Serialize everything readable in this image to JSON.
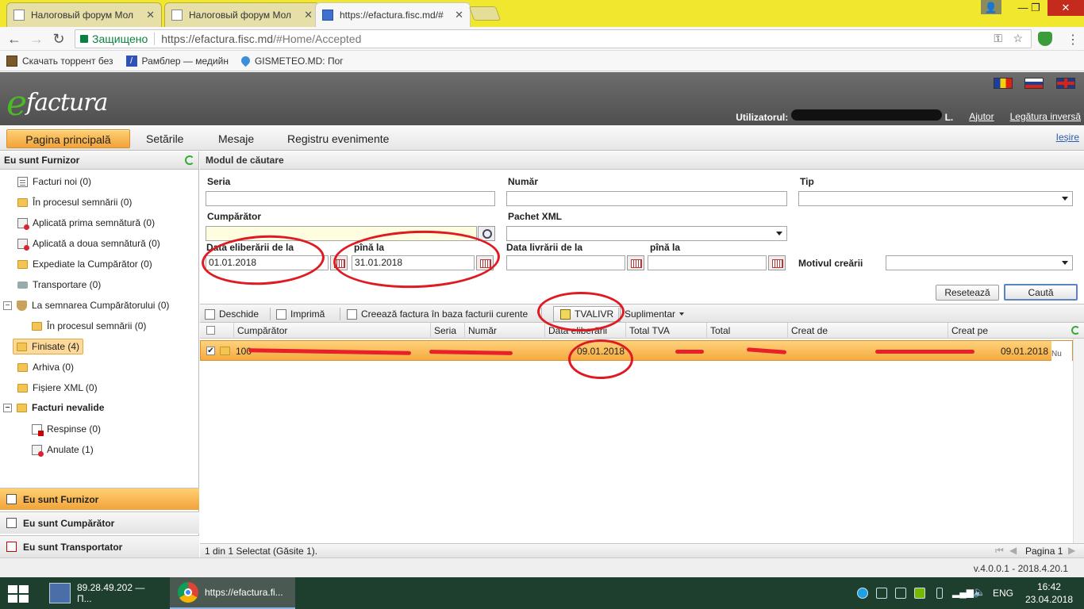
{
  "browser": {
    "tabs": [
      {
        "title": "Налоговый форум Мол",
        "active": false
      },
      {
        "title": "Налоговый форум Мол",
        "active": false
      },
      {
        "title": "https://efactura.fisc.md/#",
        "active": true
      }
    ],
    "secure_label": "Защищено",
    "url_host": "https://efactura.fisc.md",
    "url_path": "/#Home/Accepted",
    "bookmarks": [
      "Скачать торрент без",
      "Рамблер — медийн",
      "GISMETEO.MD: Пог"
    ]
  },
  "header": {
    "logo_e": "e",
    "logo_rest": "factura",
    "user_label": "Utilizatorul:",
    "user_suffix": "L.",
    "help_link": "Ajutor",
    "feedback_link": "Legătura inversă",
    "flags": [
      "moldova-flag",
      "russia-flag",
      "uk-flag"
    ]
  },
  "menu": {
    "items": [
      "Pagina principală",
      "Setările",
      "Mesaje",
      "Registru evenimente"
    ],
    "active_index": 0,
    "logout": "Ieșire"
  },
  "sidebar": {
    "title": "Eu sunt Furnizor",
    "items": [
      {
        "label": "Facturi noi (0)",
        "icon": "document-icon"
      },
      {
        "label": "În procesul semnării (0)",
        "icon": "folder-icon"
      },
      {
        "label": "Aplicată prima semnătură (0)",
        "icon": "stamp-icon"
      },
      {
        "label": "Aplicată a doua semnătură (0)",
        "icon": "stamp-icon"
      },
      {
        "label": "Expediate la Cumpărător (0)",
        "icon": "folder-icon"
      },
      {
        "label": "Transportare (0)",
        "icon": "truck-icon"
      },
      {
        "label": "La semnarea Cumpărătorului (0)",
        "icon": "shield-icon"
      },
      {
        "label": "În procesul semnării (0)",
        "icon": "folder-icon"
      },
      {
        "label": "Finisate (4)",
        "icon": "folder-icon"
      },
      {
        "label": "Arhiva (0)",
        "icon": "folder-icon"
      },
      {
        "label": "Fișiere XML (0)",
        "icon": "folder-icon"
      },
      {
        "label": "Facturi nevalide",
        "icon": "folder-icon"
      },
      {
        "label": "Respinse (0)",
        "icon": "rejected-icon"
      },
      {
        "label": "Anulate (1)",
        "icon": "cancelled-icon"
      }
    ],
    "selected_index": 8,
    "accordion": [
      {
        "label": "Eu sunt Furnizor",
        "active": true
      },
      {
        "label": "Eu sunt Cumpărător",
        "active": false
      },
      {
        "label": "Eu sunt Transportator",
        "active": false
      }
    ]
  },
  "search": {
    "title": "Modul de căutare",
    "seria_label": "Seria",
    "seria_value": "",
    "numar_label": "Număr",
    "numar_value": "",
    "tip_label": "Tip",
    "tip_value": "",
    "cumparator_label": "Cumpărător",
    "cumparator_value": "",
    "pachet_label": "Pachet XML",
    "pachet_value": "",
    "data_elib_label": "Data eliberării de la",
    "data_elib_from": "01.01.2018",
    "pina_la_label": "pînă la",
    "data_elib_to": "31.01.2018",
    "data_livr_label": "Data livrării de la",
    "data_livr_from": "",
    "pina_la_label2": "pînă la",
    "data_livr_to": "",
    "motiv_label": "Motivul creării",
    "motiv_value": "",
    "reset_button": "Resetează",
    "search_button": "Caută"
  },
  "toolbar": {
    "open": "Deschide",
    "print": "Imprimă",
    "create_based": "Creează factura în baza facturii curente",
    "tvalivr": "TVALIVR",
    "extra": "Suplimentar"
  },
  "grid": {
    "columns": [
      "",
      "Cumpărător",
      "Seria",
      "Număr",
      "Data eliberării",
      "Total TVA",
      "Total",
      "Creat de",
      "Creat pe"
    ],
    "rows": [
      {
        "cumparator": "100",
        "seria": "",
        "numar": "",
        "data": "09.01.2018",
        "tva": "",
        "total": "",
        "creat_de": "",
        "creat_pe": "09.01.2018",
        "status": "Nu"
      }
    ],
    "footer_status": "1 din 1 Selectat (Găsite 1).",
    "page_label": "Pagina 1"
  },
  "version": "v.4.0.0.1 - 2018.4.20.1",
  "taskbar": {
    "tasks": [
      "89.28.49.202 — П...",
      "https://efactura.fi..."
    ],
    "lang": "ENG",
    "time": "16:42",
    "date": "23.04.2018"
  }
}
